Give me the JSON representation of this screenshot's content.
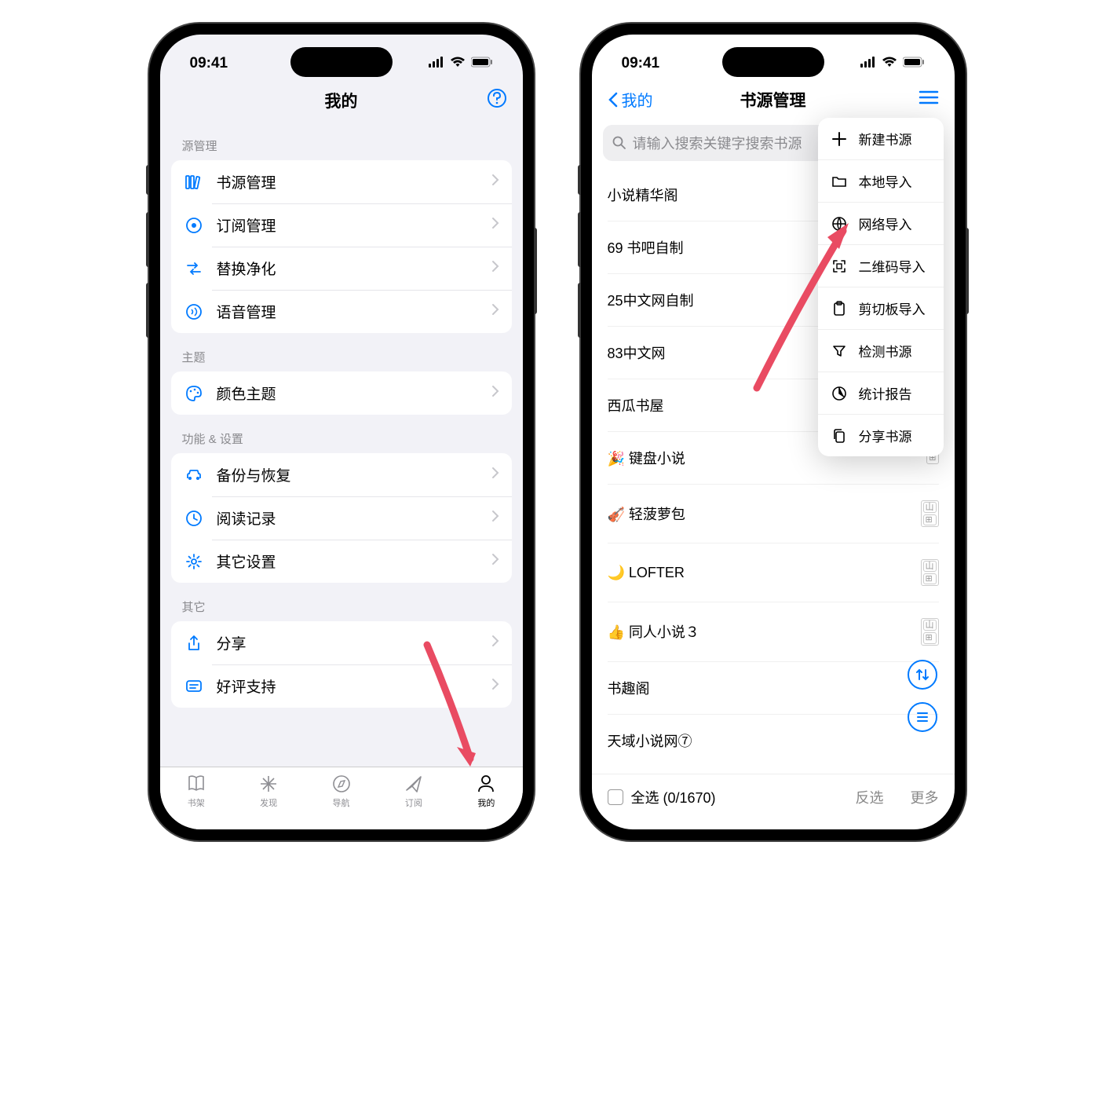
{
  "status": {
    "time": "09:41"
  },
  "phone1": {
    "nav": {
      "title": "我的"
    },
    "sections": [
      {
        "header": "源管理",
        "items": [
          {
            "icon": "books",
            "label": "书源管理"
          },
          {
            "icon": "circle-dot",
            "label": "订阅管理"
          },
          {
            "icon": "arrows",
            "label": "替换净化"
          },
          {
            "icon": "sound",
            "label": "语音管理"
          }
        ]
      },
      {
        "header": "主题",
        "items": [
          {
            "icon": "palette",
            "label": "颜色主题"
          }
        ]
      },
      {
        "header": "功能 & 设置",
        "items": [
          {
            "icon": "car",
            "label": "备份与恢复"
          },
          {
            "icon": "clock",
            "label": "阅读记录"
          },
          {
            "icon": "gear",
            "label": "其它设置"
          }
        ]
      },
      {
        "header": "其它",
        "items": [
          {
            "icon": "share",
            "label": "分享"
          },
          {
            "icon": "thumbsup",
            "label": "好评支持"
          }
        ]
      }
    ],
    "tabs": [
      {
        "icon": "book",
        "label": "书架"
      },
      {
        "icon": "grid",
        "label": "发现"
      },
      {
        "icon": "compass",
        "label": "导航"
      },
      {
        "icon": "send",
        "label": "订阅"
      },
      {
        "icon": "person",
        "label": "我的"
      }
    ]
  },
  "phone2": {
    "nav": {
      "back": "我的",
      "title": "书源管理"
    },
    "search_placeholder": "请输入搜索关键字搜索书源",
    "dropdown": [
      {
        "icon": "plus",
        "label": "新建书源"
      },
      {
        "icon": "folder",
        "label": "本地导入"
      },
      {
        "icon": "globe",
        "label": "网络导入"
      },
      {
        "icon": "qr",
        "label": "二维码导入"
      },
      {
        "icon": "clipboard",
        "label": "剪切板导入"
      },
      {
        "icon": "filter",
        "label": "检测书源"
      },
      {
        "icon": "piechart",
        "label": "统计报告"
      },
      {
        "icon": "share2",
        "label": "分享书源"
      }
    ],
    "sources": [
      "小说精华阁",
      "69 书吧自制",
      "25中文网自制",
      "83中文网",
      "西瓜书屋",
      "🎉 键盘小说",
      "🎻 轻菠萝包",
      "🌙 LOFTER",
      "👍 同人小说３",
      "书趣阁",
      "天域小说网⑦"
    ],
    "footer": {
      "select_all": "全选 (0/1670)",
      "invert": "反选",
      "more": "更多"
    }
  }
}
